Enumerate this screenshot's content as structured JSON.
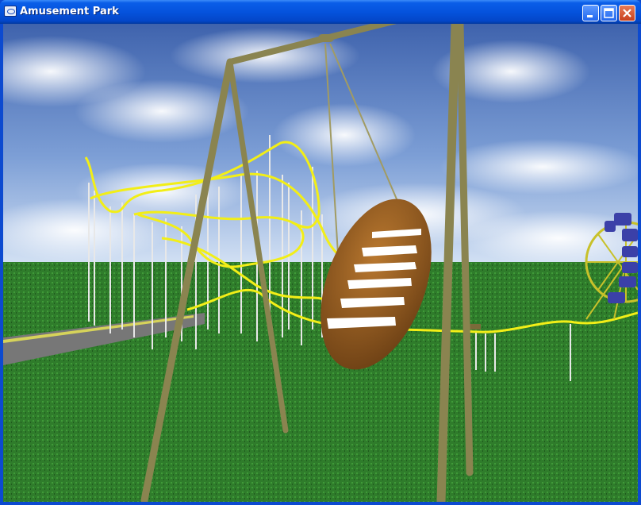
{
  "window": {
    "title": "Amusement Park",
    "icon": "app-window-icon",
    "controls": [
      {
        "name": "minimize-button",
        "icon": "minimize-icon"
      },
      {
        "name": "maximize-button",
        "icon": "maximize-icon"
      },
      {
        "name": "close-button",
        "icon": "close-icon"
      }
    ]
  },
  "scene": {
    "description_elements": [
      "sky",
      "grass-ground",
      "roller-coaster-track",
      "swinging-pirate-ship",
      "ferris-wheel",
      "walkway"
    ],
    "colors": {
      "sky_top": "#4b6fb6",
      "sky_bottom": "#c9d8ef",
      "grass": "#2e7a2a",
      "track": "#f2ee17",
      "frame": "#8a8450",
      "ship": "#9b5e22",
      "ferris_wheel": "#3b40a8"
    }
  }
}
